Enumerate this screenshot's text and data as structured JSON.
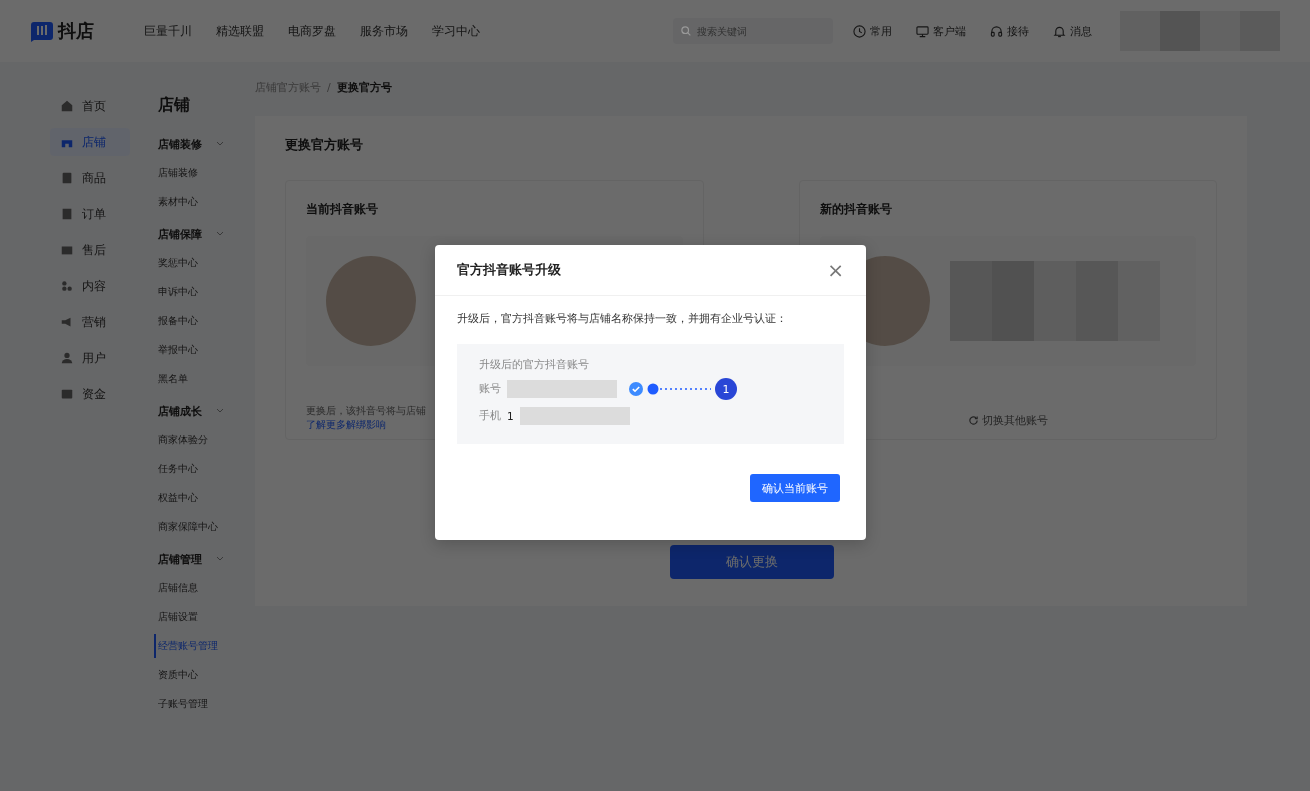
{
  "topbar": {
    "logo": "抖店",
    "nav": [
      "巨量千川",
      "精选联盟",
      "电商罗盘",
      "服务市场",
      "学习中心"
    ],
    "search": {
      "placeholder": "搜索关键词"
    },
    "actions": [
      {
        "label": "常用",
        "kind": "clock"
      },
      {
        "label": "客户端",
        "kind": "monitor"
      },
      {
        "label": "接待",
        "kind": "headset"
      },
      {
        "label": "消息",
        "kind": "bell"
      }
    ]
  },
  "sidebar": {
    "items": [
      {
        "label": "首页",
        "selected": false
      },
      {
        "label": "店铺",
        "selected": true
      },
      {
        "label": "商品",
        "selected": false
      },
      {
        "label": "订单",
        "selected": false
      },
      {
        "label": "售后",
        "selected": false
      },
      {
        "label": "内容",
        "selected": false
      },
      {
        "label": "营销",
        "selected": false
      },
      {
        "label": "用户",
        "selected": false
      },
      {
        "label": "资金",
        "selected": false
      }
    ]
  },
  "submenu": {
    "title": "店铺",
    "groups": [
      {
        "label": "店铺装修",
        "expanded": true,
        "items": [
          {
            "label": "店铺装修",
            "selected": false
          },
          {
            "label": "素材中心",
            "selected": false
          }
        ]
      },
      {
        "label": "店铺保障",
        "expanded": true,
        "items": [
          {
            "label": "奖惩中心",
            "selected": false
          },
          {
            "label": "申诉中心",
            "selected": false
          },
          {
            "label": "报备中心",
            "selected": false
          },
          {
            "label": "举报中心",
            "selected": false
          },
          {
            "label": "黑名单",
            "selected": false
          }
        ]
      },
      {
        "label": "店铺成长",
        "expanded": true,
        "items": [
          {
            "label": "商家体验分",
            "selected": false
          },
          {
            "label": "任务中心",
            "selected": false
          },
          {
            "label": "权益中心",
            "selected": false
          },
          {
            "label": "商家保障中心",
            "selected": false
          }
        ]
      },
      {
        "label": "店铺管理",
        "expanded": true,
        "items": [
          {
            "label": "店铺信息",
            "selected": false
          },
          {
            "label": "店铺设置",
            "selected": false
          },
          {
            "label": "经营账号管理",
            "selected": true
          },
          {
            "label": "资质中心",
            "selected": false
          },
          {
            "label": "子账号管理",
            "selected": false
          }
        ]
      }
    ]
  },
  "breadcrumb": {
    "items": [
      "店铺官方账号",
      "更换官方号"
    ],
    "separator": "/"
  },
  "page": {
    "title": "更换官方账号",
    "current_account": {
      "title": "当前抖音账号",
      "note": "更换后，该抖音号将与店铺",
      "link": "了解更多解绑影响"
    },
    "new_account": {
      "title": "新的抖音账号",
      "switch_label": "切换其他账号"
    },
    "confirm_button": "确认更换"
  },
  "modal": {
    "title": "官方抖音账号升级",
    "close": "×",
    "description": "升级后，官方抖音账号将与店铺名称保持一致，并拥有企业号认证：",
    "box_title": "升级后的官方抖音账号",
    "account_label": "账号",
    "phone_label": "手机",
    "phone_value": "1",
    "step": "1",
    "button": "确认当前账号"
  }
}
